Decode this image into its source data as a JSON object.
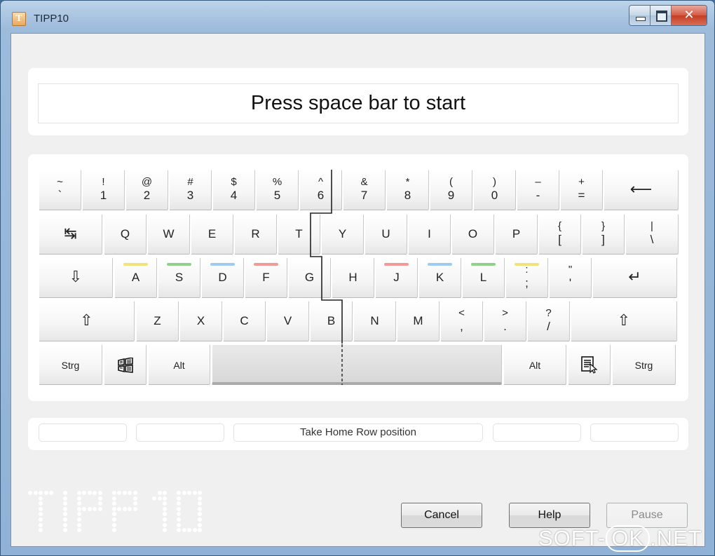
{
  "window": {
    "title": "TIPP10",
    "app_icon_letter": "T",
    "close_glyph": "✕"
  },
  "prompt": {
    "text": "Press space bar to start"
  },
  "keyboard": {
    "number_row": [
      {
        "top": "~",
        "bottom": "`"
      },
      {
        "top": "!",
        "bottom": "1"
      },
      {
        "top": "@",
        "bottom": "2"
      },
      {
        "top": "#",
        "bottom": "3"
      },
      {
        "top": "$",
        "bottom": "4"
      },
      {
        "top": "%",
        "bottom": "5"
      },
      {
        "top": "^",
        "bottom": "6"
      },
      {
        "top": "&",
        "bottom": "7"
      },
      {
        "top": "*",
        "bottom": "8"
      },
      {
        "top": "(",
        "bottom": "9"
      },
      {
        "top": ")",
        "bottom": "0"
      },
      {
        "top": "–",
        "bottom": "-"
      },
      {
        "top": "+",
        "bottom": "="
      }
    ],
    "backspace_icon": "⟵",
    "tab_icon": "↹",
    "top_row": [
      "Q",
      "W",
      "E",
      "R",
      "T",
      "Y",
      "U",
      "I",
      "O",
      "P"
    ],
    "top_row_extra": [
      {
        "top": "{",
        "bottom": "["
      },
      {
        "top": "}",
        "bottom": "]"
      },
      {
        "top": "|",
        "bottom": "\\"
      }
    ],
    "caps_icon": "⇩",
    "home_row": [
      "A",
      "S",
      "D",
      "F",
      "G",
      "H",
      "J",
      "K",
      "L"
    ],
    "home_row_extra": [
      {
        "top": ":",
        "bottom": ";"
      },
      {
        "top": "\"",
        "bottom": "'"
      }
    ],
    "enter_icon": "↵",
    "shift_icon": "⇧",
    "bottom_row": [
      "Z",
      "X",
      "C",
      "V",
      "B",
      "N",
      "M"
    ],
    "bottom_row_extra": [
      {
        "top": "<",
        "bottom": ","
      },
      {
        "top": ">",
        "bottom": "."
      },
      {
        "top": "?",
        "bottom": "/"
      }
    ],
    "ctrl_label": "Strg",
    "alt_label": "Alt",
    "windows_icon": "windows-icon",
    "menu_icon": "menu-icon",
    "finger_colors": {
      "pinky": "#f2e27a",
      "ring": "#8fd38a",
      "middle": "#9ecbf0",
      "index": "#f19a98"
    }
  },
  "status": {
    "fields": [
      "",
      "",
      "Take Home Row position",
      "",
      ""
    ]
  },
  "logo_text": "TIPP10",
  "buttons": {
    "cancel": "Cancel",
    "help": "Help",
    "pause": "Pause"
  },
  "watermark": {
    "left": "SOFT-",
    "ok": "OK",
    "right": ".NET"
  }
}
